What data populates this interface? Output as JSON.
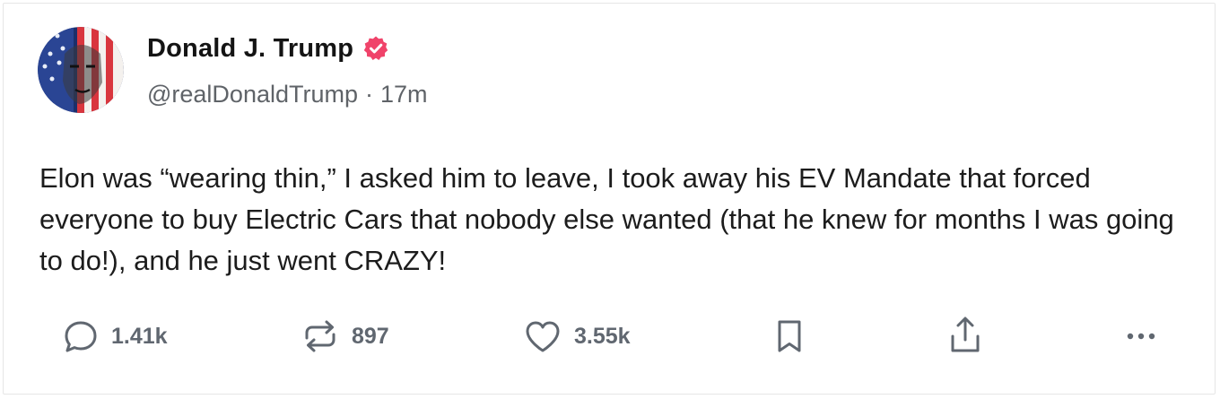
{
  "post": {
    "author": {
      "display_name": "Donald J. Trump",
      "handle": "@realDonaldTrump",
      "verified_color": "#f0436a"
    },
    "time_ago": "17m",
    "separator": "·",
    "text": "Elon was “wearing thin,” I asked him to leave, I took away his EV Mandate that forced everyone to buy Electric Cars that nobody else wanted (that he knew for months I was going to do!), and he just went CRAZY!",
    "stats": {
      "replies": "1.41k",
      "reposts": "897",
      "likes": "3.55k"
    }
  },
  "icons": {
    "reply": "speech-bubble-icon",
    "repost": "repost-arrows-icon",
    "like": "heart-icon",
    "bookmark": "bookmark-icon",
    "share": "share-upload-icon",
    "more": "more-dots-icon",
    "verified": "verified-badge-icon"
  },
  "colors": {
    "text": "#1c1c1c",
    "muted": "#606770",
    "border": "#e6e6e6"
  }
}
